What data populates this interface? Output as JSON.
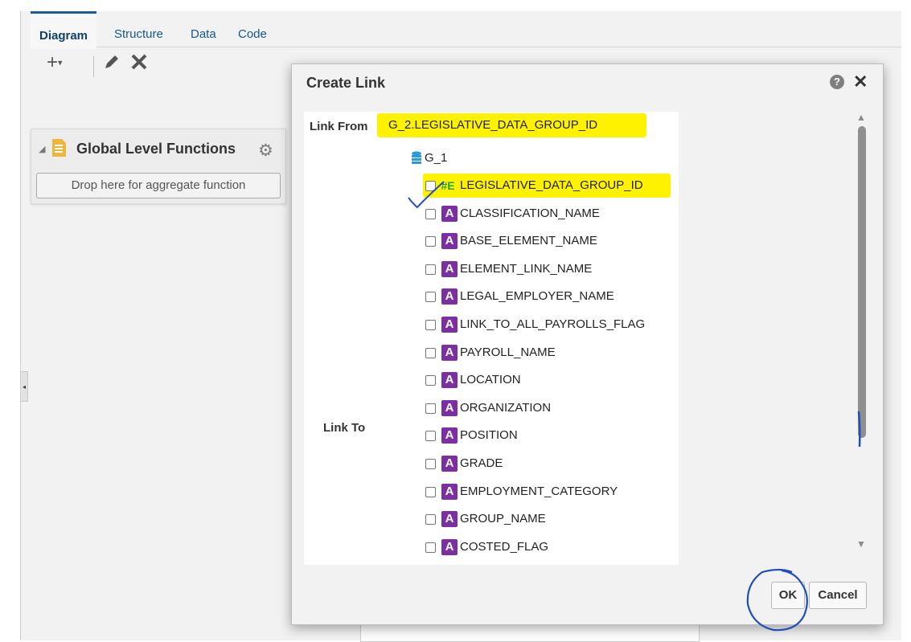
{
  "tabs": [
    {
      "label": "Diagram",
      "active": true
    },
    {
      "label": "Structure",
      "active": false
    },
    {
      "label": "Data",
      "active": false
    },
    {
      "label": "Code",
      "active": false
    }
  ],
  "toolbar": {
    "icons": [
      "add-menu-icon",
      "edit-pencil-icon",
      "delete-x-icon"
    ]
  },
  "global_panel": {
    "title": "Global Level Functions",
    "drop_zone": "Drop here for aggregate function"
  },
  "dialog": {
    "title": "Create Link",
    "link_from_label": "Link From",
    "link_from_value": "G_2.LEGISLATIVE_DATA_GROUP_ID",
    "link_to_label": "Link To",
    "group": "G_1",
    "fields": [
      {
        "name": "LEGISLATIVE_DATA_GROUP_ID",
        "type": "number",
        "type_glyph": "#E",
        "highlighted": true
      },
      {
        "name": "CLASSIFICATION_NAME",
        "type": "text",
        "type_glyph": "A"
      },
      {
        "name": "BASE_ELEMENT_NAME",
        "type": "text",
        "type_glyph": "A"
      },
      {
        "name": "ELEMENT_LINK_NAME",
        "type": "text",
        "type_glyph": "A"
      },
      {
        "name": "LEGAL_EMPLOYER_NAME",
        "type": "text",
        "type_glyph": "A"
      },
      {
        "name": "LINK_TO_ALL_PAYROLLS_FLAG",
        "type": "text",
        "type_glyph": "A"
      },
      {
        "name": "PAYROLL_NAME",
        "type": "text",
        "type_glyph": "A"
      },
      {
        "name": "LOCATION",
        "type": "text",
        "type_glyph": "A"
      },
      {
        "name": "ORGANIZATION",
        "type": "text",
        "type_glyph": "A"
      },
      {
        "name": "POSITION",
        "type": "text",
        "type_glyph": "A"
      },
      {
        "name": "GRADE",
        "type": "text",
        "type_glyph": "A"
      },
      {
        "name": "EMPLOYMENT_CATEGORY",
        "type": "text",
        "type_glyph": "A"
      },
      {
        "name": "GROUP_NAME",
        "type": "text",
        "type_glyph": "A"
      },
      {
        "name": "COSTED_FLAG",
        "type": "text",
        "type_glyph": "A"
      }
    ],
    "help_glyph": "?",
    "close_glyph": "✕",
    "ok_label": "OK",
    "cancel_label": "Cancel"
  },
  "colors": {
    "highlight": "#fff200",
    "text_type_icon": "#7b2fa3",
    "number_type_icon": "#23a23b",
    "annotation_ink": "#1f4fbf",
    "tab_blue": "#14588f"
  }
}
